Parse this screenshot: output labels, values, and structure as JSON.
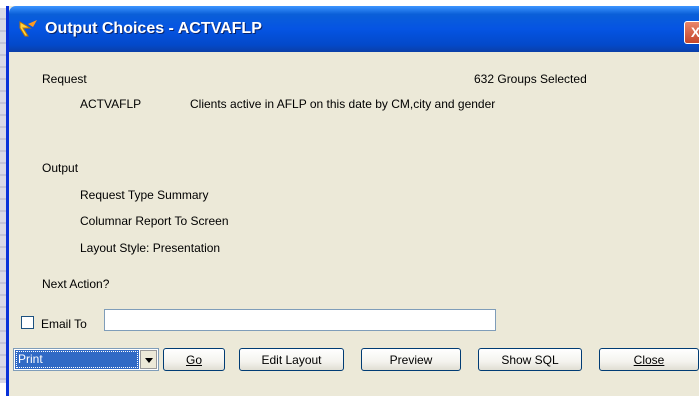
{
  "window": {
    "title": "Output Choices - ACTVAFLP",
    "close_glyph": "X",
    "icon": "app-arrow-icon"
  },
  "request": {
    "label": "Request",
    "groups_selected": "632 Groups Selected",
    "code": "ACTVAFLP",
    "description": "Clients active in AFLP on this date by CM,city and gender"
  },
  "output": {
    "label": "Output",
    "lines": [
      "Request Type Summary",
      "Columnar Report To Screen",
      "Layout Style: Presentation"
    ]
  },
  "next_action_label": "Next Action?",
  "email": {
    "label": "Email To",
    "checked": false,
    "value": ""
  },
  "action": {
    "selected": "Print"
  },
  "buttons": {
    "go": "Go",
    "edit_layout": "Edit Layout",
    "preview": "Preview",
    "show_sql": "Show SQL",
    "close": "Close"
  }
}
